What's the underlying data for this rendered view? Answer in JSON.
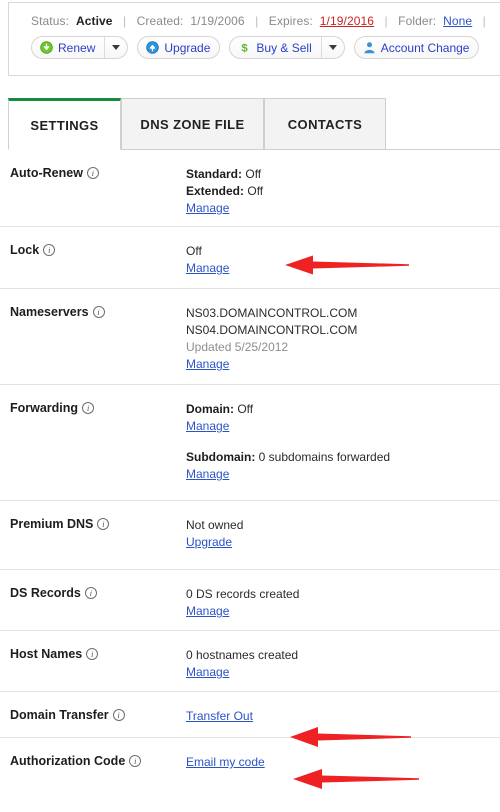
{
  "header": {
    "status_label": "Status:",
    "status_value": "Active",
    "created_label": "Created:",
    "created_value": "1/19/2006",
    "expires_label": "Expires:",
    "expires_value": "1/19/2016",
    "folder_label": "Folder:",
    "folder_value": "None",
    "separator": "|",
    "buttons": [
      {
        "label": "Renew",
        "icon": "renew-down-arrow-icon",
        "icon_color": "#5cb82b",
        "has_caret": true
      },
      {
        "label": "Upgrade",
        "icon": "upgrade-up-arrow-icon",
        "icon_color": "#1a7fd4",
        "has_caret": false
      },
      {
        "label": "Buy & Sell",
        "icon": "dollar-sign-icon",
        "icon_color": "#5cb82b",
        "has_caret": true
      },
      {
        "label": "Account Change",
        "icon": "person-icon",
        "icon_color": "#3c8fd6",
        "has_caret": false
      }
    ]
  },
  "tabs": [
    {
      "label": "SETTINGS",
      "active": true
    },
    {
      "label": "DNS ZONE FILE",
      "active": false
    },
    {
      "label": "CONTACTS",
      "active": false
    }
  ],
  "settings": {
    "auto_renew": {
      "label": "Auto-Renew",
      "standard_key": "Standard:",
      "standard_value": "Off",
      "extended_key": "Extended:",
      "extended_value": "Off",
      "manage": "Manage"
    },
    "lock": {
      "label": "Lock",
      "value": "Off",
      "manage": "Manage"
    },
    "nameservers": {
      "label": "Nameservers",
      "ns1": "NS03.DOMAINCONTROL.COM",
      "ns2": "NS04.DOMAINCONTROL.COM",
      "updated": "Updated 5/25/2012",
      "manage": "Manage"
    },
    "forwarding": {
      "label": "Forwarding",
      "domain_key": "Domain:",
      "domain_value": "Off",
      "domain_manage": "Manage",
      "subdomain_key": "Subdomain:",
      "subdomain_value": "0 subdomains forwarded",
      "subdomain_manage": "Manage"
    },
    "premium_dns": {
      "label": "Premium DNS",
      "value": "Not owned",
      "action": "Upgrade"
    },
    "ds_records": {
      "label": "DS Records",
      "value": "0 DS records created",
      "manage": "Manage"
    },
    "host_names": {
      "label": "Host Names",
      "value": "0 hostnames created",
      "manage": "Manage"
    },
    "domain_transfer": {
      "label": "Domain Transfer",
      "action": "Transfer Out"
    },
    "authorization_code": {
      "label": "Authorization Code",
      "action": "Email my code"
    }
  },
  "annotations": {
    "arrow_color": "#ee2222",
    "arrows": [
      {
        "name": "arrow-pointing-lock-manage"
      },
      {
        "name": "arrow-pointing-transfer-out"
      },
      {
        "name": "arrow-pointing-email-my-code"
      }
    ]
  },
  "colors": {
    "link": "#2b53c8",
    "active_tab_accent": "#1a8a3c",
    "expiry_warning": "#cc2222",
    "divider": "#e2e2e2"
  }
}
